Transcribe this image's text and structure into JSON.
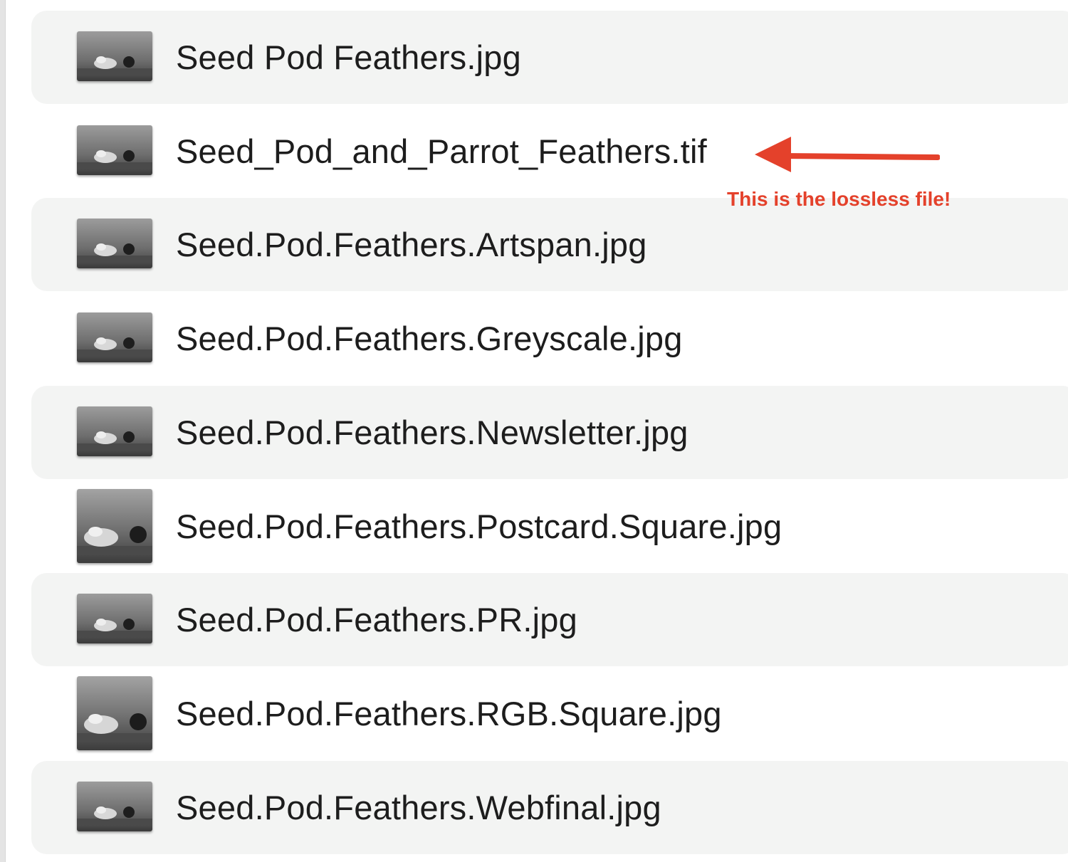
{
  "file_list": {
    "items": [
      {
        "name": "Seed Pod Feathers.jpg",
        "thumbnail_icon": "image-thumbnail-icon"
      },
      {
        "name": "Seed_Pod_and_Parrot_Feathers.tif",
        "thumbnail_icon": "image-thumbnail-icon"
      },
      {
        "name": "Seed.Pod.Feathers.Artspan.jpg",
        "thumbnail_icon": "image-thumbnail-icon"
      },
      {
        "name": "Seed.Pod.Feathers.Greyscale.jpg",
        "thumbnail_icon": "image-thumbnail-icon"
      },
      {
        "name": "Seed.Pod.Feathers.Newsletter.jpg",
        "thumbnail_icon": "image-thumbnail-icon"
      },
      {
        "name": "Seed.Pod.Feathers.Postcard.Square.jpg",
        "thumbnail_icon": "image-thumbnail-icon"
      },
      {
        "name": "Seed.Pod.Feathers.PR.jpg",
        "thumbnail_icon": "image-thumbnail-icon"
      },
      {
        "name": "Seed.Pod.Feathers.RGB.Square.jpg",
        "thumbnail_icon": "image-thumbnail-icon"
      },
      {
        "name": "Seed.Pod.Feathers.Webfinal.jpg",
        "thumbnail_icon": "image-thumbnail-icon"
      }
    ]
  },
  "annotation": {
    "text": "This is the lossless file!",
    "color": "#e4412b",
    "arrow_icon": "left-arrow-icon"
  },
  "colors": {
    "row_alternate_background": "#f3f4f3",
    "text": "#1d1d1d"
  }
}
